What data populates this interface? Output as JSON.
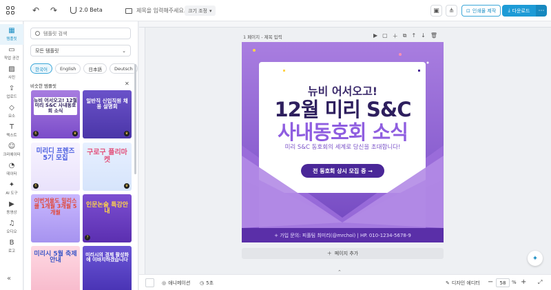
{
  "header": {
    "version": "2.0 Beta",
    "title_placeholder": "제목을 입력해주세요.",
    "size_button": "크기 조정",
    "print_label": "인쇄물 제작",
    "download_label": "다운로드",
    "more": "⋯"
  },
  "nav": [
    {
      "label": "템플릿",
      "icon": "▦"
    },
    {
      "label": "작업 공간",
      "icon": "▭"
    },
    {
      "label": "사진",
      "icon": "▨"
    },
    {
      "label": "업로드",
      "icon": "⇪"
    },
    {
      "label": "요소",
      "icon": "◇"
    },
    {
      "label": "텍스트",
      "icon": "T"
    },
    {
      "label": "크리에이터",
      "icon": "☺"
    },
    {
      "label": "데이터",
      "icon": "◔"
    },
    {
      "label": "AI 도구",
      "icon": "✦"
    },
    {
      "label": "동영상",
      "icon": "▶"
    },
    {
      "label": "오디오",
      "icon": "♫"
    },
    {
      "label": "로고",
      "icon": "B"
    }
  ],
  "panel": {
    "search_placeholder": "템플릿 검색",
    "filter": "모든 템플릿",
    "chips": [
      "한국어",
      "English",
      "日本語",
      "Deutsch"
    ],
    "similar_title": "비슷한 템플릿",
    "thumbs": [
      {
        "t": "뉴비 어서오고! 12월 미리 S&C 사내동호회 소식"
      },
      {
        "t": "일반직 신입직원 채용 설명회"
      },
      {
        "t": "미리디 프렌즈 5기 모집"
      },
      {
        "t": "구로구 플리마켓"
      },
      {
        "t": "이번겨울도 밀리스쿨 1개월 3개월 5개월"
      },
      {
        "t": "인문논술 특강안내"
      },
      {
        "t": "미리시 5월 축제 안내"
      },
      {
        "t": "미리시의 경제 활성화에 이바지하겠습니다"
      }
    ]
  },
  "canvas": {
    "page_label": "1 페이지 - 제목 입력",
    "design": {
      "sub": "뉴비 어서오고!",
      "main1": "12월 미리 S&C",
      "main2": "사내동호회 소식",
      "desc": "미리 S&C 동호회의 세계로 당신을 초대합니다!",
      "pill": "전 동호회 상시 모집 중 →",
      "footer": "+ 가입 문의: 피플팀 최미리(@mrchoi)  |  HP. 010-1234-5678-9"
    },
    "add_page": "페이지 추가"
  },
  "bottom": {
    "animation": "애니메이션",
    "time": "5초",
    "editor": "디자인 에디터",
    "zoom": "58",
    "pct": "%"
  }
}
